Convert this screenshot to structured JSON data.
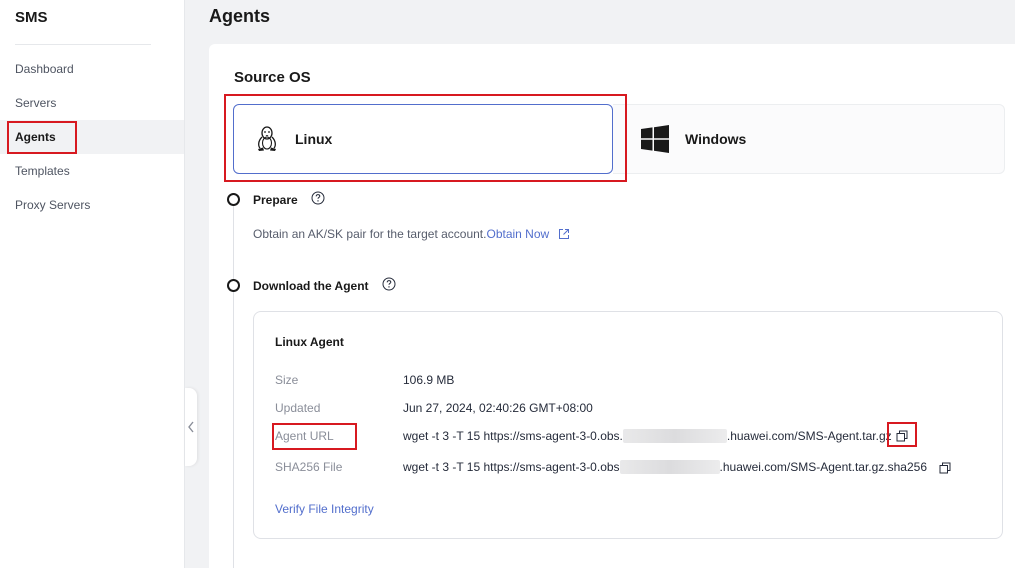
{
  "sidebar": {
    "brand": "SMS",
    "items": [
      {
        "label": "Dashboard"
      },
      {
        "label": "Servers"
      },
      {
        "label": "Agents"
      },
      {
        "label": "Templates"
      },
      {
        "label": "Proxy Servers"
      }
    ],
    "active_item": "Agents"
  },
  "page": {
    "title": "Agents"
  },
  "source_os": {
    "title": "Source OS",
    "options": [
      {
        "label": "Linux",
        "icon": "linux-penguin-icon",
        "selected": true
      },
      {
        "label": "Windows",
        "icon": "windows-logo-icon",
        "selected": false
      }
    ]
  },
  "steps": {
    "prepare": {
      "title": "Prepare",
      "description": "Obtain an AK/SK pair for the target account.",
      "link_label": "Obtain Now"
    },
    "download": {
      "title": "Download the Agent"
    }
  },
  "agent_panel": {
    "title": "Linux Agent",
    "size_label": "Size",
    "size_value": "106.9 MB",
    "updated_label": "Updated",
    "updated_value": "Jun 27, 2024, 02:40:26 GMT+08:00",
    "url_label": "Agent URL",
    "url_value_prefix": "wget -t 3 -T 15 https://sms-agent-3-0.obs.",
    "url_value_suffix": ".huawei.com/SMS-Agent.tar.gz",
    "sha_label": "SHA256 File",
    "sha_value_prefix": "wget -t 3 -T 15 https://sms-agent-3-0.obs",
    "sha_value_suffix": ".huawei.com/SMS-Agent.tar.gz.sha256",
    "verify_label": "Verify File Integrity"
  },
  "colors": {
    "accent": "#526ecc",
    "highlight": "#d71920"
  }
}
